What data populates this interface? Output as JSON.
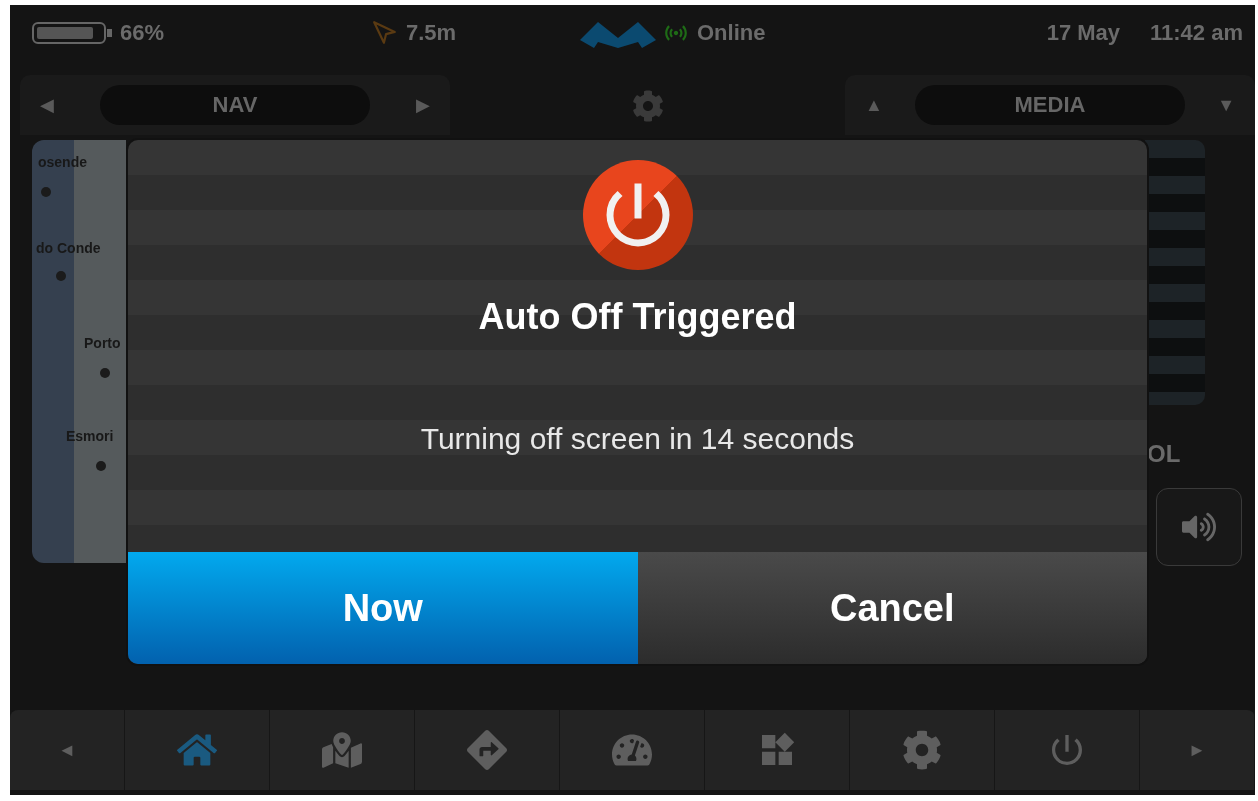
{
  "status_bar": {
    "battery": "66%",
    "gps_accuracy": "7.5m",
    "connection": "Online",
    "date": "17 May",
    "time": "11:42 am"
  },
  "left_panel": {
    "prev": "◀",
    "title": "NAV",
    "next": "▶",
    "map_labels": [
      {
        "text": "osende"
      },
      {
        "text": "do Conde"
      },
      {
        "text": "Porto"
      },
      {
        "text": "Esmori"
      }
    ]
  },
  "right_panel": {
    "prev": "▲",
    "title": "MEDIA",
    "next": "▼",
    "label": "OL"
  },
  "dialog": {
    "title": "Auto Off Triggered",
    "message": "Turning off screen in 14 seconds",
    "buttons": [
      {
        "label": "Now",
        "kind": "primary"
      },
      {
        "label": "Cancel",
        "kind": "secondary"
      }
    ]
  },
  "bottom_nav": {
    "prev": "◄",
    "next": "►",
    "items": [
      {
        "kind": "home",
        "selected": true
      },
      {
        "kind": "map",
        "selected": false
      },
      {
        "kind": "directions",
        "selected": false
      },
      {
        "kind": "gauge",
        "selected": false
      },
      {
        "kind": "apps",
        "selected": false
      },
      {
        "kind": "settings",
        "selected": false
      },
      {
        "kind": "power",
        "selected": false
      }
    ]
  }
}
